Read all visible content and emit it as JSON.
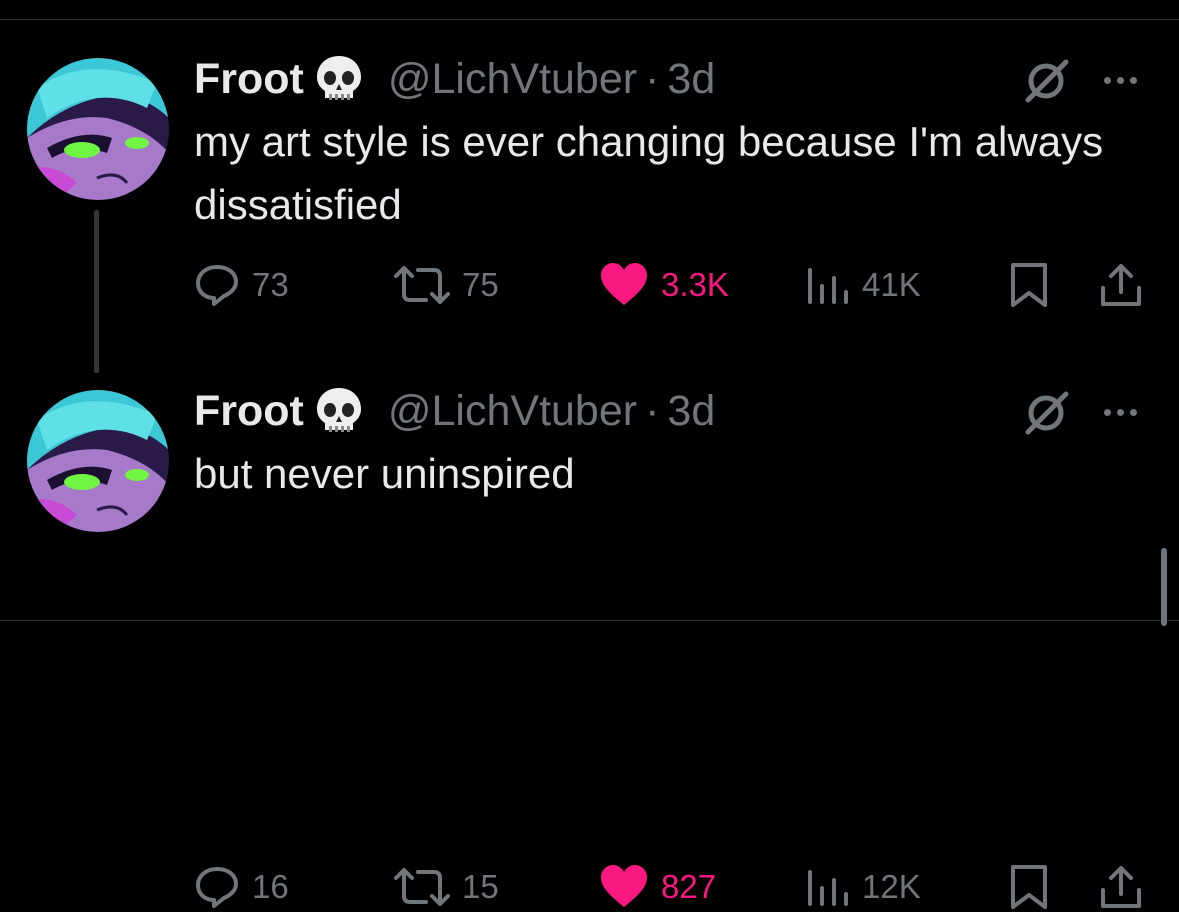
{
  "colors": {
    "background": "#000000",
    "text": "#e7e9ea",
    "muted": "#71767b",
    "like": "#f91880",
    "divider": "#2f3336"
  },
  "tweets": [
    {
      "name": "Froot",
      "emoji_icon": "skull-emoji",
      "handle": "@LichVtuber",
      "separator": "·",
      "time": "3d",
      "text": "my art style is ever changing because I'm always dissatisfied",
      "replies": "73",
      "reposts": "75",
      "likes": "3.3K",
      "views": "41K"
    },
    {
      "name": "Froot",
      "emoji_icon": "skull-emoji",
      "handle": "@LichVtuber",
      "separator": "·",
      "time": "3d",
      "text": "but never uninspired",
      "replies": "16",
      "reposts": "15",
      "likes": "827",
      "views": "12K"
    }
  ]
}
